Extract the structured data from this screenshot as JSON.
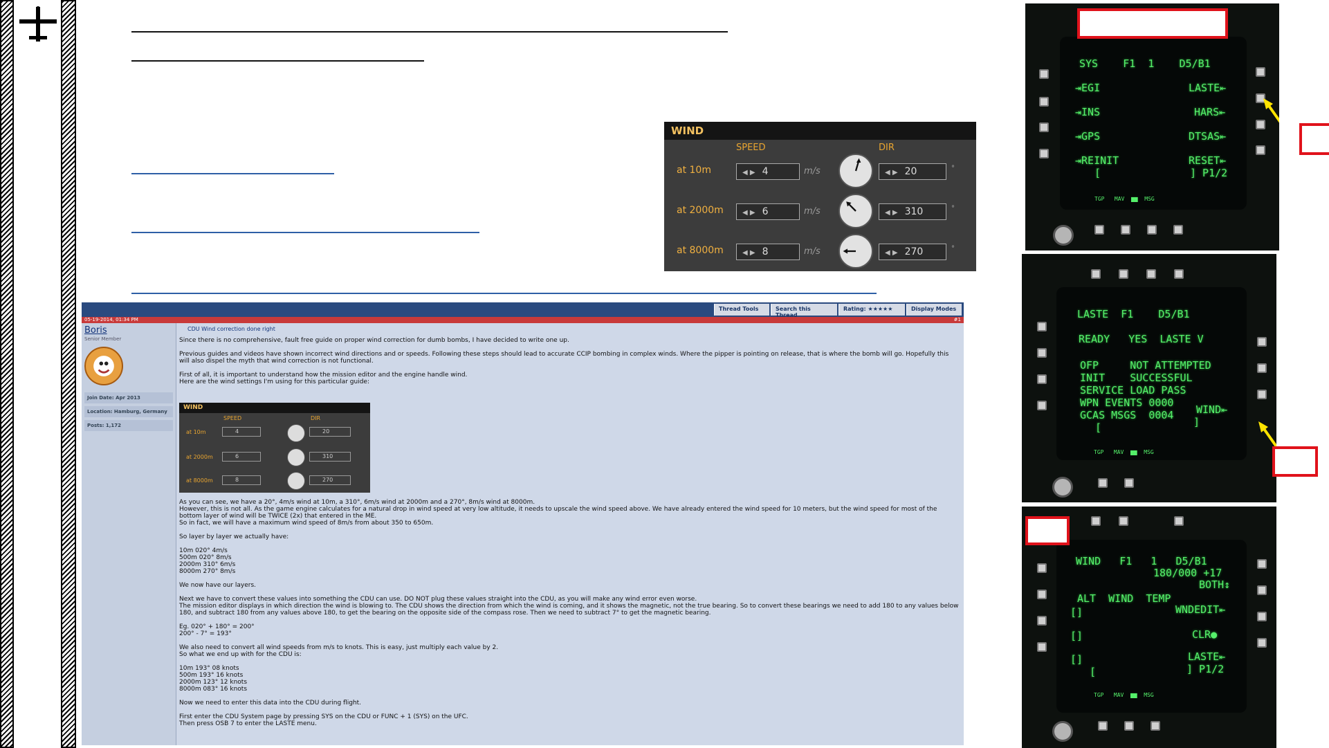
{
  "slide": {
    "plane_icon": "airplane-icon"
  },
  "wind_panel": {
    "title": "WIND",
    "speed_header": "SPEED",
    "dir_header": "DIR",
    "unit": "m/s",
    "deg": "°",
    "rows": [
      {
        "label": "at 10m",
        "speed": "4",
        "dir": "20"
      },
      {
        "label": "at 2000m",
        "speed": "6",
        "dir": "310"
      },
      {
        "label": "at 8000m",
        "speed": "8",
        "dir": "270"
      }
    ]
  },
  "forum": {
    "tools": [
      "Thread Tools",
      "Search this Thread",
      "Rating: ★★★★★",
      "Display Modes"
    ],
    "date": "05-19-2014, 01:34 PM",
    "post_no": "#1",
    "user": "Boris",
    "user_title": "Senior Member",
    "join": "Join Date: Apr 2013",
    "location": "Location: Hamburg, Germany",
    "posts": "Posts: 1,172",
    "subject": "CDU Wind correction done right",
    "p1": "Since there is no comprehensive, fault free guide on proper wind correction for dumb bombs, I have decided to write one up.",
    "p2": "Previous guides and videos have shown incorrect wind directions and or speeds. Following these steps should lead to accurate CCIP bombing in complex winds. Where the pipper is pointing on release, that is where the bomb will go. Hopefully this will also dispel the myth that wind correction is not functional.",
    "p3": "First of all, it is important to understand how the mission editor and the engine handle wind.\nHere are the wind settings I'm using for this particular guide:",
    "p4": "As you can see, we have a 20°, 4m/s wind at 10m, a 310°, 6m/s wind at 2000m and a 270°, 8m/s wind at 8000m.\nHowever, this is not all. As the game engine calculates for a natural drop in wind speed at very low altitude, it needs to upscale the wind speed above. We have already entered the wind speed for 10 meters, but the wind speed for most of the bottom layer of wind will be TWICE (2x) that entered in the ME.\nSo in fact, we will have a maximum wind speed of 8m/s from about 350 to 650m.",
    "p5": "So layer by layer we actually have:",
    "p6": "10m 020° 4m/s\n500m 020° 8m/s\n2000m 310° 6m/s\n8000m 270° 8m/s",
    "p7": "We now have our layers.",
    "p8": "Next we have to convert these values into something the CDU can use. DO NOT plug these values straight into the CDU, as you will make any wind error even worse.\nThe mission editor displays in which direction the wind is blowing to. The CDU shows the direction from which the wind is coming, and it shows the magnetic, not the true bearing. So to convert these bearings we need to add 180 to any values below 180, and subtract 180 from any values above 180, to get the bearing on the opposite side of the compass rose. Then we need to subtract 7° to get the magnetic bearing.",
    "p9": "Eg. 020° + 180° = 200°\n200° - 7° = 193°",
    "p10": "We also need to convert all wind speeds from m/s to knots. This is easy, just multiply each value by 2.\nSo what we end up with for the CDU is:",
    "p11": "10m 193° 08 knots\n500m 193° 16 knots\n2000m 123° 12 knots\n8000m 083° 16 knots",
    "p12": "Now we need to enter this data into the CDU during flight.",
    "p13": "First enter the CDU System page by pressing SYS on the CDU or FUNC + 1 (SYS) on the UFC.\nThen press OSB 7 to enter the LASTE menu."
  },
  "cdu1": {
    "r1": "SYS    F1  1    D5/B1",
    "l2": "⇥EGI",
    "r2": "LASTE⇤",
    "l3": "⇥INS",
    "r3": "HARS⇤",
    "l4": "⇥GPS",
    "r4": "DTSAS⇤",
    "l5": "⇥REINIT",
    "r5": "RESET⇤",
    "l6": "[",
    "r6": "] P1/2",
    "soft": "TGP   MAV  ▆▆  MSG"
  },
  "cdu2": {
    "r1": "LASTE  F1    D5/B1",
    "r2": "READY   YES  LASTE V",
    "r3": "OFP     NOT ATTEMPTED",
    "r4": "INIT    SUCCESSFUL",
    "r5": "SERVICE LOAD PASS",
    "r6": "WPN EVENTS 0000",
    "r7": "GCAS MSGS  0004",
    "r7b": "WIND⇤",
    "r8": "[",
    "r8b": "]",
    "soft": "TGP   MAV  ▆▆  MSG"
  },
  "cdu3": {
    "r1": "WIND   F1   1   D5/B1",
    "r2": "180/000 +17",
    "r3": "BOTH↕",
    "r4": "ALT  WIND  TEMP",
    "r5": "WNDEDIT⇤",
    "r6": "[]",
    "r7": "[]",
    "r7b": "CLR●",
    "r8": "[]",
    "r9": "[",
    "r9b": "LASTE⇤",
    "r10": "] P1/2",
    "soft": "TGP   MAV  ▆▆  MSG"
  },
  "colors": {
    "accent_red": "#e0121b",
    "cdu_green": "#55f06a",
    "arrow_yellow": "#ffe400"
  }
}
